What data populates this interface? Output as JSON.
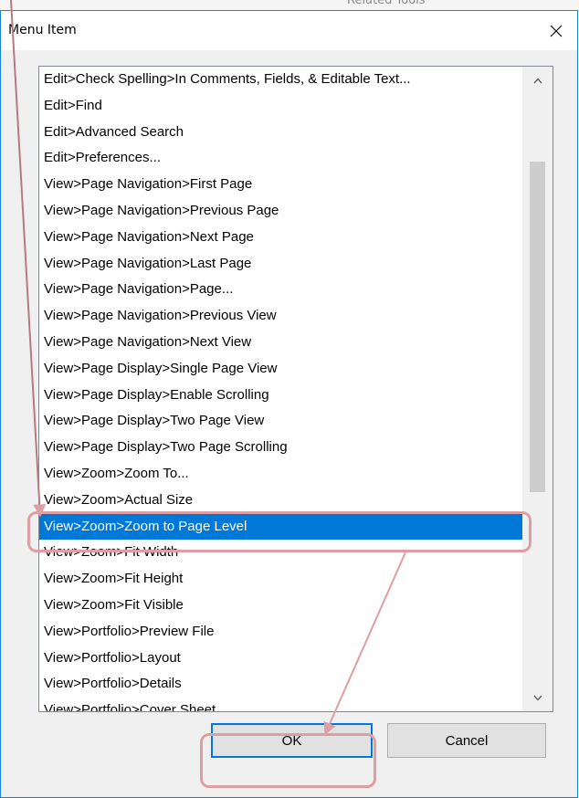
{
  "dialog": {
    "title": "Menu Item",
    "background_text": "Related Tools"
  },
  "list": {
    "items": [
      "Edit>Check Spelling>In Comments, Fields, & Editable Text...",
      "Edit>Find",
      "Edit>Advanced Search",
      "Edit>Preferences...",
      "View>Page Navigation>First Page",
      "View>Page Navigation>Previous Page",
      "View>Page Navigation>Next Page",
      "View>Page Navigation>Last Page",
      "View>Page Navigation>Page...",
      "View>Page Navigation>Previous View",
      "View>Page Navigation>Next View",
      "View>Page Display>Single Page View",
      "View>Page Display>Enable Scrolling",
      "View>Page Display>Two Page View",
      "View>Page Display>Two Page Scrolling",
      "View>Zoom>Zoom To...",
      "View>Zoom>Actual Size",
      "View>Zoom>Zoom to Page Level",
      "View>Zoom>Fit Width",
      "View>Zoom>Fit Height",
      "View>Zoom>Fit Visible",
      "View>Portfolio>Preview File",
      "View>Portfolio>Layout",
      "View>Portfolio>Details",
      "View>Portfolio>Cover Sheet"
    ],
    "selected_index": 17
  },
  "buttons": {
    "ok_label": "OK",
    "cancel_label": "Cancel"
  },
  "icons": {
    "close": "close-icon",
    "scroll_up": "chevron-up-icon",
    "scroll_down": "chevron-down-icon"
  },
  "colors": {
    "selection": "#0078d7",
    "annotation": "#dd9fa3",
    "dialog_border": "#1883d7"
  }
}
